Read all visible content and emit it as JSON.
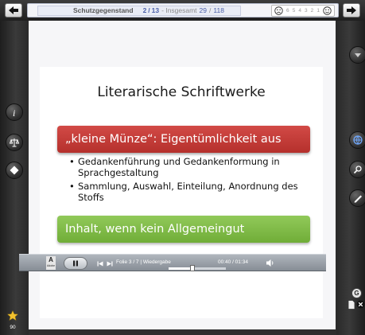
{
  "topbar": {
    "topic": "Schutzgegenstand",
    "current_slide": "2",
    "total_slides": "13",
    "total_label": "- Insgesamt",
    "overall_current": "29",
    "overall_total": "118",
    "rating_labels": [
      "6",
      "5",
      "4",
      "3",
      "2",
      "1"
    ]
  },
  "slide": {
    "title": "Literarische Schriftwerke",
    "highlight_red": "„kleine Münze“: Eigentümlichkeit aus",
    "bullets": [
      "Gedankenführung und Gedankenformung in Sprachgestaltung",
      "Sammlung, Auswahl, Einteilung, Anordnung des Stoffs"
    ],
    "highlight_green": "Inhalt, wenn kein Allgemeingut"
  },
  "player": {
    "logo_text": "Adobe",
    "slide_info": "Folie 3 / 7 | Wiedergabe",
    "time": "00:40 / 01:34",
    "progress": 0.42
  },
  "sidebar": {
    "star_count": "90",
    "badge_g": "G"
  },
  "colors": {
    "red_box": "#c13b37",
    "green_box": "#7fbb46",
    "accent_blue": "#4a5fa8"
  }
}
